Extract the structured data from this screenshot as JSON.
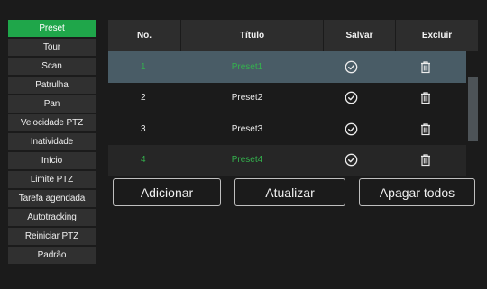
{
  "sidebar": {
    "items": [
      {
        "label": "Preset",
        "active": true
      },
      {
        "label": "Tour"
      },
      {
        "label": "Scan"
      },
      {
        "label": "Patrulha"
      },
      {
        "label": "Pan"
      },
      {
        "label": "Velocidade PTZ"
      },
      {
        "label": "Inatividade"
      },
      {
        "label": "Início"
      },
      {
        "label": "Limite PTZ"
      },
      {
        "label": "Tarefa agendada"
      },
      {
        "label": "Autotracking"
      },
      {
        "label": "Reiniciar PTZ"
      },
      {
        "label": "Padrão"
      }
    ]
  },
  "table": {
    "headers": {
      "no": "No.",
      "title": "Título",
      "save": "Salvar",
      "delete": "Excluir"
    },
    "rows": [
      {
        "no": "1",
        "title": "Preset1"
      },
      {
        "no": "2",
        "title": "Preset2"
      },
      {
        "no": "3",
        "title": "Preset3"
      },
      {
        "no": "4",
        "title": "Preset4"
      }
    ],
    "save_icon": "check-circle-icon",
    "delete_icon": "trash-icon"
  },
  "actions": {
    "add": "Adicionar",
    "refresh": "Atualizar",
    "delete_all": "Apagar todos"
  },
  "colors": {
    "accent": "#1fa64a",
    "selected_row": "#495c66",
    "green_text": "#34b14d"
  }
}
